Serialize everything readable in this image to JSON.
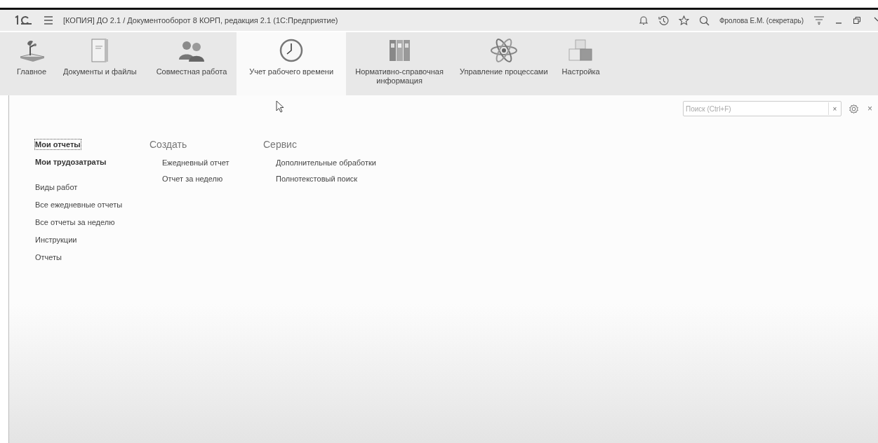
{
  "window": {
    "title": "[КОПИЯ] ДО 2.1 / Документооборот 8 КОРП, редакция 2.1  (1С:Предприятие)",
    "user": "Фролова Е.М. (секретарь)"
  },
  "sections": [
    {
      "label": "Главное",
      "selected": false
    },
    {
      "label": "Документы и файлы",
      "selected": false
    },
    {
      "label": "Совместная работа",
      "selected": false
    },
    {
      "label": "Учет рабочего времени",
      "selected": true
    },
    {
      "label": "Нормативно-справочная информация",
      "selected": false
    },
    {
      "label": "Управление процессами",
      "selected": false
    },
    {
      "label": "Настройка",
      "selected": false
    }
  ],
  "search": {
    "placeholder": "Поиск (Ctrl+F)",
    "clear": "×",
    "close": "×"
  },
  "nav": [
    [
      {
        "label": "Мои отчеты",
        "bold": true,
        "focused": true
      },
      {
        "label": "Мои трудозатраты",
        "bold": true,
        "focused": false
      }
    ],
    [
      {
        "label": "Виды работ",
        "bold": false,
        "focused": false
      },
      {
        "label": "Все ежедневные отчеты",
        "bold": false,
        "focused": false
      },
      {
        "label": "Все отчеты за неделю",
        "bold": false,
        "focused": false
      },
      {
        "label": "Инструкции",
        "bold": false,
        "focused": false
      },
      {
        "label": "Отчеты",
        "bold": false,
        "focused": false
      }
    ]
  ],
  "groups": [
    {
      "title": "Создать",
      "items": [
        "Ежедневный отчет",
        "Отчет за неделю"
      ]
    },
    {
      "title": "Сервис",
      "items": [
        "Дополнительные обработки",
        "Полнотекстовый поиск"
      ]
    }
  ]
}
